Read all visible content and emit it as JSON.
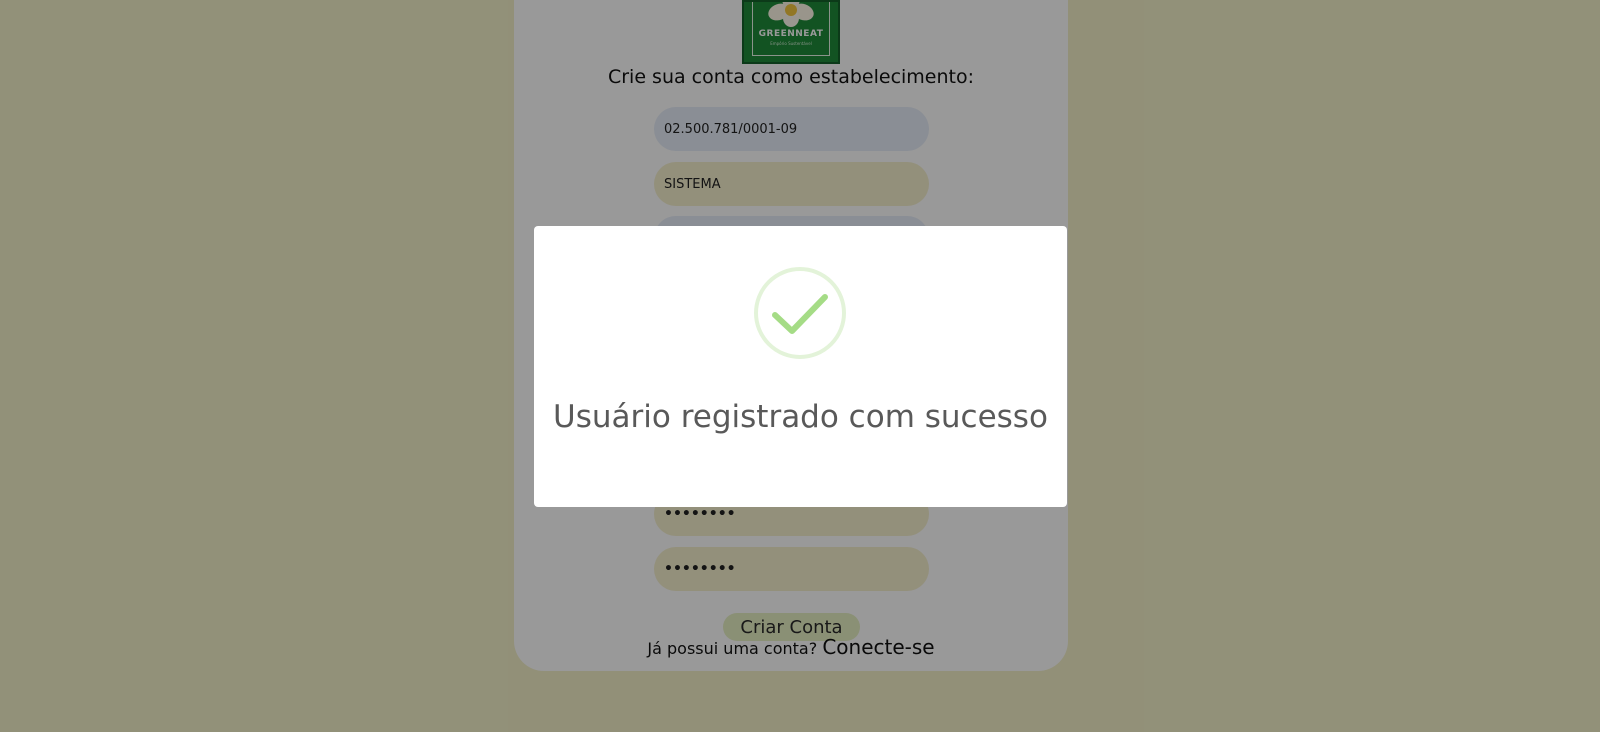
{
  "logo": {
    "brand": "GREENNEAT",
    "tagline": "Empório Sustentável"
  },
  "form": {
    "title": "Crie sua conta como estabelecimento:",
    "fields": [
      {
        "value": "02.500.781/0001-09"
      },
      {
        "value": "SISTEMA"
      },
      {
        "value": ""
      },
      {
        "value": "••••••••"
      },
      {
        "value": "••••••••"
      }
    ],
    "submit_label": "Criar Conta",
    "login_prompt": "Já possui uma conta?",
    "login_link": "Conecte-se"
  },
  "modal": {
    "icon": "success-check-icon",
    "title": "Usuário registrado com sucesso"
  },
  "colors": {
    "background": "#f3f1c9",
    "logo_green": "#1e8a3a",
    "success_green": "#a5dc86"
  }
}
